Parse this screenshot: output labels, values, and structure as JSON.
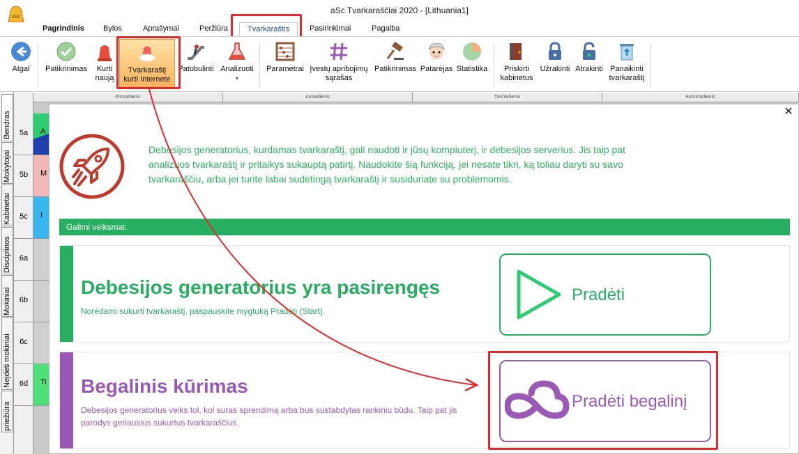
{
  "window": {
    "title": "aSc Tvarkaraščiai 2020  - [Lithuania1]"
  },
  "menu": {
    "tabs": [
      "Pagrindinis",
      "Bylos",
      "Aprašymai",
      "Peržiūra",
      "Tvarkaraštis",
      "Pasirinkimai",
      "Pagalba"
    ],
    "active": "Tvarkaraštis"
  },
  "ribbon": {
    "back": "Atgal",
    "check": "Patikrinimas",
    "create_new": [
      "Kurti",
      "naują"
    ],
    "online": [
      "Tvarkaraštį",
      "kurti Internete"
    ],
    "improve": "Patobulinti",
    "analyze": "Analizuoti",
    "params": "Parametrai",
    "constraints": [
      "Įvestų apribojimų",
      "sąrašas"
    ],
    "check2": "Patikrinimas",
    "advisor": "Patarėjas",
    "stats": "Statistika",
    "assign_rooms": [
      "Priskirti",
      "kabinetus"
    ],
    "lock": "Užrakinti",
    "unlock": "Atrakinti",
    "delete": [
      "Panaikinti",
      "tvarkaraštį"
    ]
  },
  "sidebar_tabs": [
    "Bendras",
    "Mokytojai",
    "Kabinetai",
    "Disciplinos",
    "Mokiniai",
    "Neįdėti mokiniai",
    "priežiūra"
  ],
  "grid": {
    "columns": [
      "Pirmadienis",
      "Antradienis",
      "Trečiadienis",
      "Ketvirtadienis"
    ],
    "rows": [
      "5a",
      "5b",
      "5c",
      "6a",
      "6b",
      "6c",
      "6d"
    ],
    "cells": [
      "A",
      "M",
      "I",
      "",
      "",
      "",
      "Ti"
    ]
  },
  "panel": {
    "intro": "Debesijos generatorius, kurdamas tvarkaraštį, gali naudoti ir jūsų kompiuterį, ir debesijos serverius. Jis taip pat analizuos tvarkaraštį ir pritaikys sukauptą patirtį. Naudokite šią funkciją, jei nesate tikri, ką toliau daryti su savo tvarkaraščiu, arba jei turite labai sudėtingą tvarkaraštį ir susiduriate su problemomis.",
    "actions_label": "Galimi veiksmai:",
    "card1": {
      "title": "Debesijos generatorius yra pasirengęs",
      "desc": "Norėdami sukurti tvarkaraštį, paspauskite mygtuką Pradėti (Start).",
      "button": "Pradėti"
    },
    "card2": {
      "title": "Begalinis kūrimas",
      "desc": "Debesijos generatorius veiks tol, kol suras sprendimą arba bus sustabdytas rankiniu būdu. Taip pat jis parodys geriausius sukurtus tvarkaraščius.",
      "button": "Pradėti begalinį"
    }
  },
  "colors": {
    "green": "#27ae60",
    "purple": "#9b59b6",
    "red_annotation": "#e5262a",
    "rocket": "#c0392b"
  }
}
